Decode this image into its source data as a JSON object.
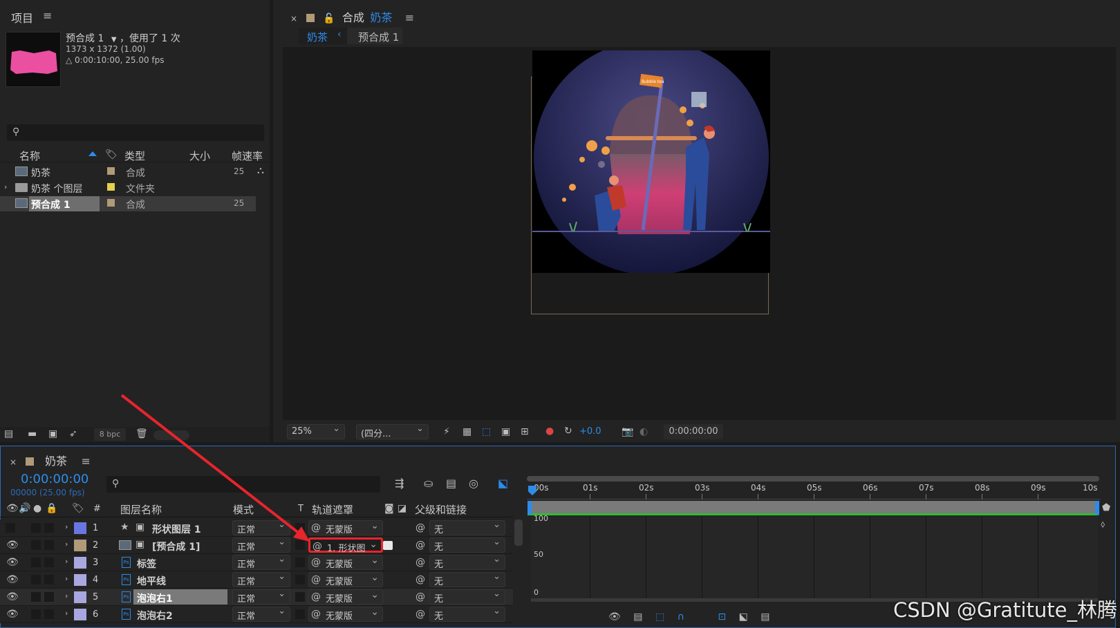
{
  "project": {
    "title": "项目",
    "item_name": "预合成 1",
    "item_usage": "，使用了 1 次",
    "item_size": "1373 x 1372 (1.00)",
    "item_duration": "△ 0:00:10:00, 25.00 fps",
    "search_placeholder": "",
    "columns": [
      "名称",
      "类型",
      "大小",
      "帧速率"
    ],
    "rows": [
      {
        "name": "奶茶",
        "type": "合成",
        "fps": "25",
        "color": "#b19a78",
        "selected": false
      },
      {
        "name": "奶茶 个图层",
        "type": "文件夹",
        "fps": "",
        "color": "#e3d24a",
        "selected": false
      },
      {
        "name": "预合成 1",
        "type": "合成",
        "fps": "25",
        "color": "#b19a78",
        "selected": true
      }
    ],
    "bpc": "8 bpc"
  },
  "viewer": {
    "tab_prefix": "合成",
    "tab_name": "奶茶",
    "breadcrumb": [
      "奶茶",
      "预合成 1"
    ],
    "sign_text": "Bubble tea",
    "zoom": "25%",
    "resolution": "(四分...",
    "exposure": "+0.0",
    "timecode": "0:00:00:00"
  },
  "timeline": {
    "tab": "奶茶",
    "timecode": "0:00:00:00",
    "frames": "00000 (25.00 fps)",
    "columns": {
      "num": "#",
      "name": "图层名称",
      "mode": "模式",
      "t": "T",
      "matte": "轨道遮罩",
      "parent": "父级和链接"
    },
    "layers": [
      {
        "num": "1",
        "name": "形状图层 1",
        "mode": "正常",
        "matte": "无蒙版",
        "parent": "无",
        "color": "#6a76e0",
        "eye": false,
        "kind": "shape"
      },
      {
        "num": "2",
        "name": "[预合成 1]",
        "mode": "正常",
        "matte": "1. 形状图",
        "parent": "无",
        "color": "#b19a78",
        "eye": true,
        "kind": "comp"
      },
      {
        "num": "3",
        "name": "标签",
        "mode": "正常",
        "matte": "无蒙版",
        "parent": "无",
        "color": "#a9a7e0",
        "eye": true,
        "kind": "ps"
      },
      {
        "num": "4",
        "name": "地平线",
        "mode": "正常",
        "matte": "无蒙版",
        "parent": "无",
        "color": "#a9a7e0",
        "eye": true,
        "kind": "ps"
      },
      {
        "num": "5",
        "name": "泡泡右1",
        "mode": "正常",
        "matte": "无蒙版",
        "parent": "无",
        "color": "#a9a7e0",
        "eye": true,
        "kind": "ps"
      },
      {
        "num": "6",
        "name": "泡泡右2",
        "mode": "正常",
        "matte": "无蒙版",
        "parent": "无",
        "color": "#a9a7e0",
        "eye": true,
        "kind": "ps"
      }
    ],
    "ruler": [
      "00s",
      "01s",
      "02s",
      "03s",
      "04s",
      "05s",
      "06s",
      "07s",
      "08s",
      "09s",
      "10s"
    ],
    "graph_labels": [
      "100",
      "50",
      "0"
    ]
  },
  "watermark": "CSDN @Gratitute_林腾"
}
